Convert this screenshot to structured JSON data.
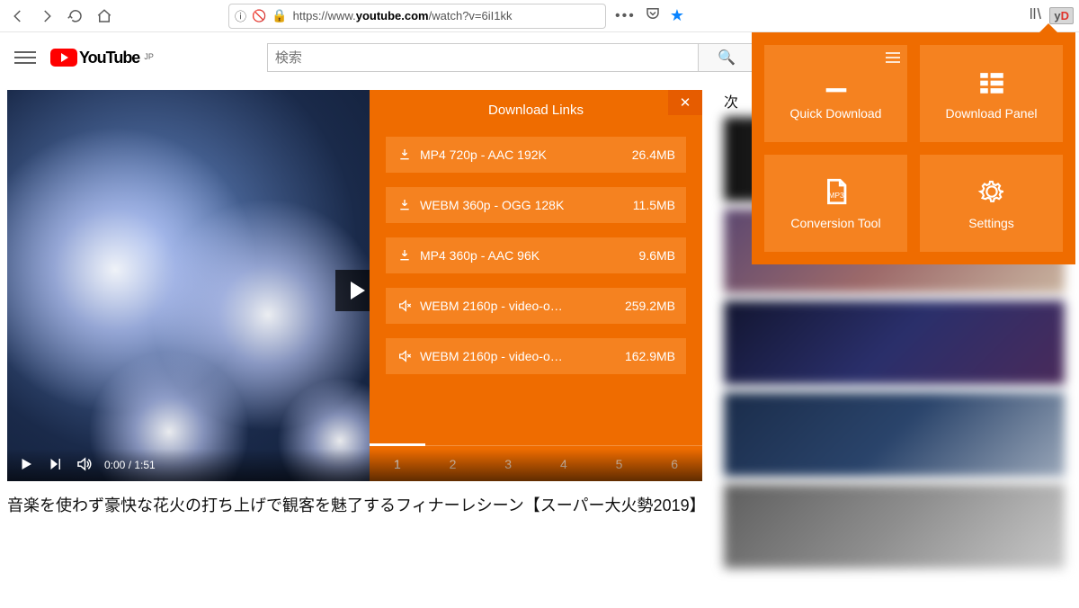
{
  "browser": {
    "url_prefix": "https://www.",
    "url_host": "youtube.com",
    "url_rest": "/watch?v=6iI1kk"
  },
  "youtube": {
    "logo_text": "YouTube",
    "region": "JP",
    "search_placeholder": "検索",
    "video_title": "音楽を使わず豪快な花火の打ち上げで観客を魅了するフィナーレシーン【スーパー大火勢2019】",
    "time_current": "0:00",
    "time_total": "1:51",
    "next_label": "次"
  },
  "download_panel": {
    "title": "Download Links",
    "items": [
      {
        "icon": "download",
        "label": "MP4 720p - AAC 192K",
        "size": "26.4MB"
      },
      {
        "icon": "download",
        "label": "WEBM 360p - OGG 128K",
        "size": "11.5MB"
      },
      {
        "icon": "download",
        "label": "MP4 360p - AAC 96K",
        "size": "9.6MB"
      },
      {
        "icon": "mute",
        "label": "WEBM 2160p - video-o…",
        "size": "259.2MB"
      },
      {
        "icon": "mute",
        "label": "WEBM 2160p - video-o…",
        "size": "162.9MB"
      }
    ],
    "pages": [
      "1",
      "2",
      "3",
      "4",
      "5",
      "6"
    ],
    "active_page": 0
  },
  "extension_popup": {
    "cards": [
      {
        "label": "Quick Download"
      },
      {
        "label": "Download Panel"
      },
      {
        "label": "Conversion Tool"
      },
      {
        "label": "Settings"
      }
    ]
  },
  "ext_button": {
    "y": "y",
    "d": "D"
  }
}
